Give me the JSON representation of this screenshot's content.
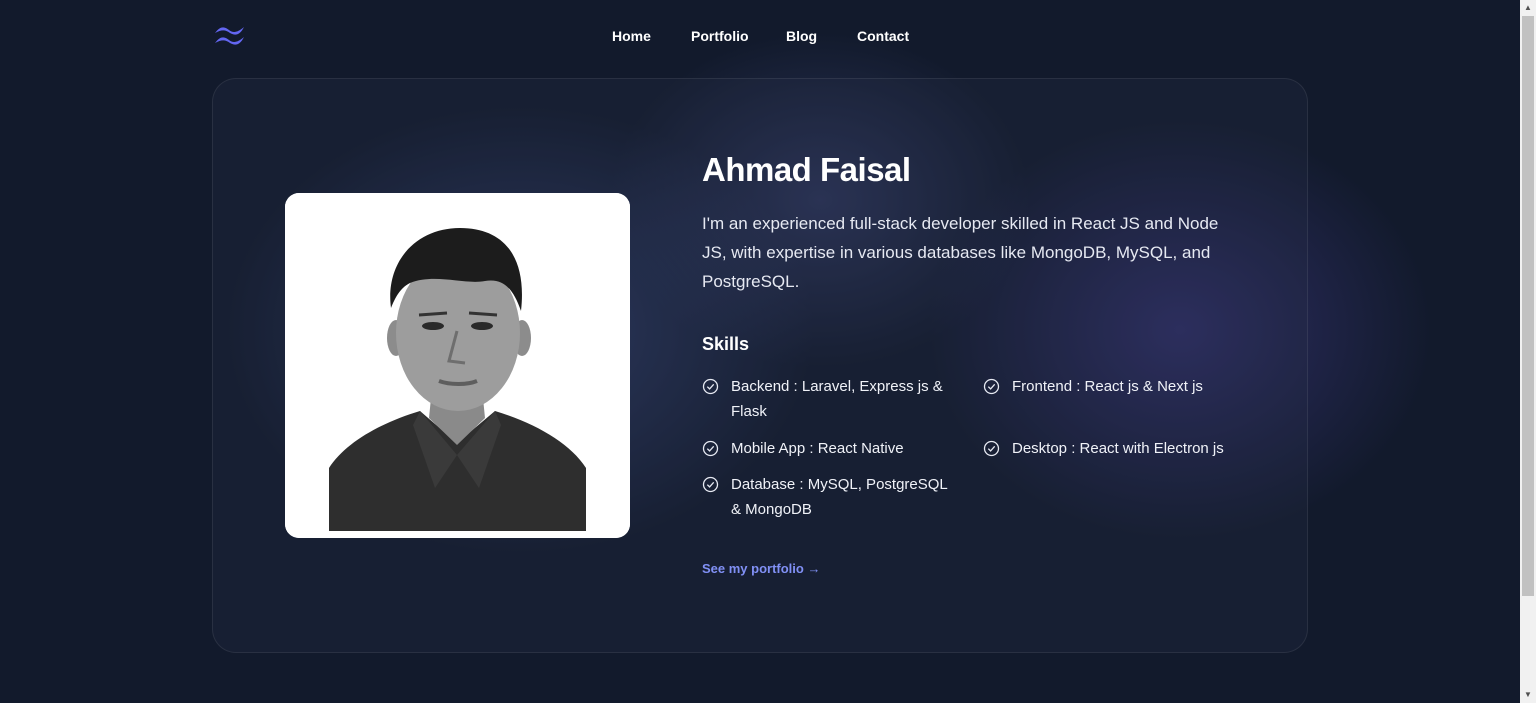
{
  "nav": {
    "items": [
      "Home",
      "Portfolio",
      "Blog",
      "Contact"
    ]
  },
  "logo": {
    "icon": "wave-logo-icon",
    "color": "#6366f1"
  },
  "profile": {
    "name": "Ahmad Faisal",
    "intro": "I'm an experienced full-stack developer skilled in React JS and Node JS, with expertise in various databases like MongoDB, MySQL, and PostgreSQL.",
    "photo": "profile-photo"
  },
  "skills": {
    "title": "Skills",
    "items": [
      "Backend : Laravel, Express js & Flask",
      "Frontend : React js & Next js",
      "Mobile App : React Native",
      "Desktop : React with Electron js",
      "Database : MySQL, PostgreSQL & MongoDB"
    ],
    "icon": "check-circle-icon"
  },
  "cta": {
    "label": "See my portfolio →",
    "color": "#8190f5"
  },
  "colors": {
    "background": "#121a2c",
    "accent": "#6366f1"
  }
}
